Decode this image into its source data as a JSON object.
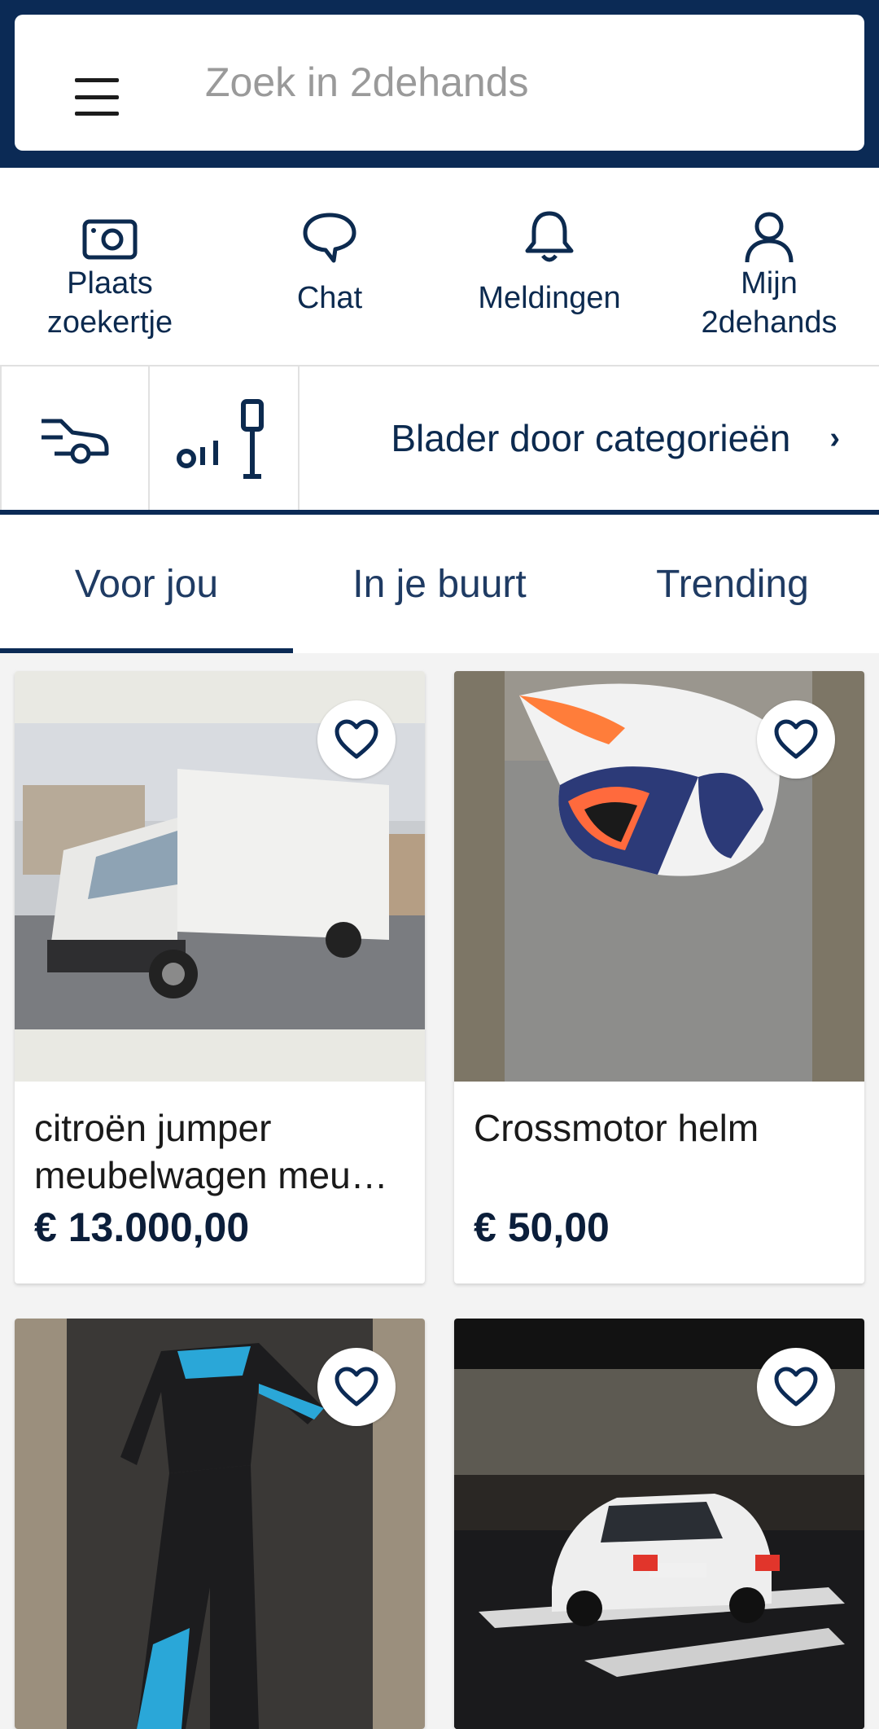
{
  "search": {
    "placeholder": "Zoek in 2dehands",
    "menu_icon": "hamburger-icon"
  },
  "actions": [
    {
      "label": "Plaats\nzoekertje",
      "icon": "camera-icon"
    },
    {
      "label": "Chat",
      "icon": "chat-bubble-icon"
    },
    {
      "label": "Meldingen",
      "icon": "bell-icon"
    },
    {
      "label": "Mijn\n2dehands",
      "icon": "user-icon"
    }
  ],
  "categories": {
    "icons": [
      "car-icon",
      "lamp-icon"
    ],
    "browse_label": "Blader door categorieën",
    "chevron": "›"
  },
  "tabs": [
    {
      "label": "Voor jou",
      "active": true
    },
    {
      "label": "In je buurt",
      "active": false
    },
    {
      "label": "Trending",
      "active": false
    }
  ],
  "listings": [
    {
      "title": "citroën jumper meubelwagen meu…",
      "price": "€ 13.000,00",
      "image": "white-box-truck-photo"
    },
    {
      "title": "Crossmotor helm",
      "price": "€ 50,00",
      "image": "motocross-helmet-photo"
    },
    {
      "title": "",
      "price": "",
      "image": "motocross-outfit-photo"
    },
    {
      "title": "",
      "price": "",
      "image": "white-hatchback-car-night-photo"
    }
  ],
  "colors": {
    "brand_navy": "#0b2a55",
    "text": "#0c2a4f"
  }
}
